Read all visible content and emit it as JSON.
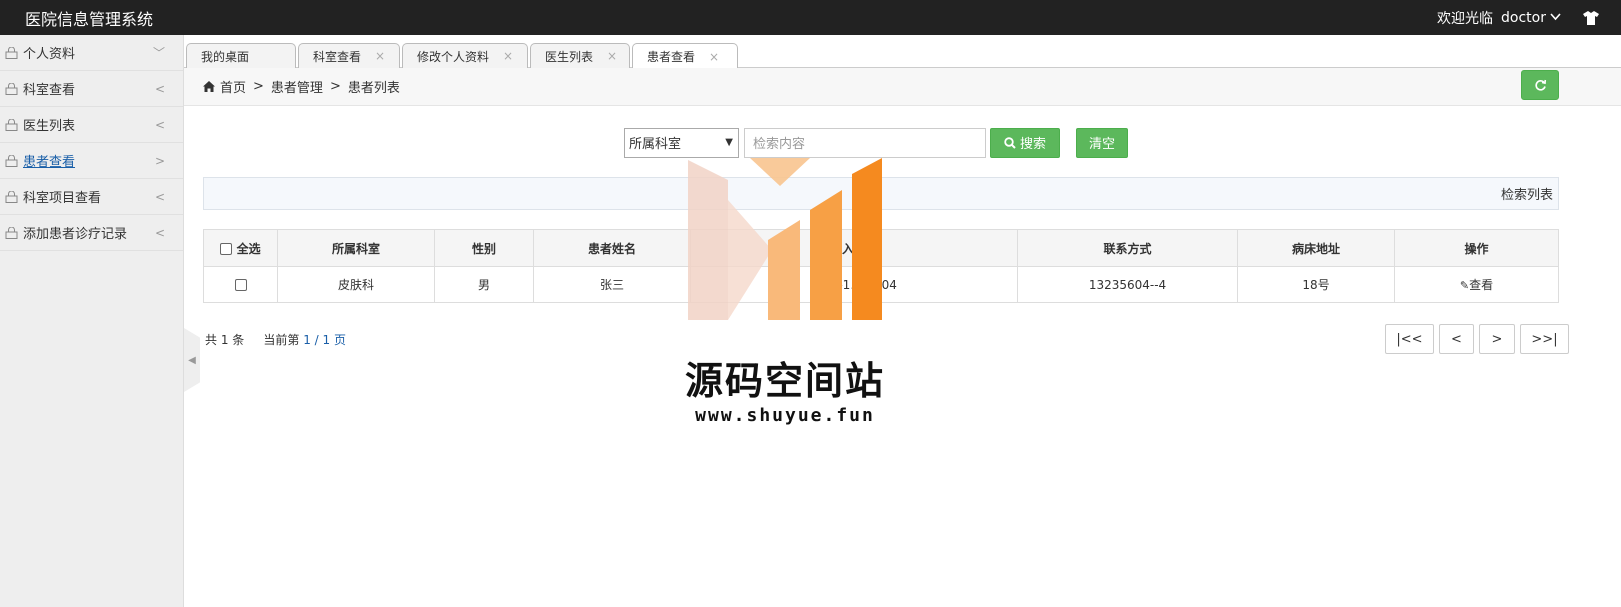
{
  "app": {
    "title": "医院信息管理系统",
    "welcome": "欢迎光临",
    "username": "doctor",
    "user_menu_icon": "chevron-down-icon",
    "theme_icon": "shirt-icon"
  },
  "sidebar": {
    "items": [
      {
        "label": "个人资料",
        "arrow": "﹀"
      },
      {
        "label": "科室查看",
        "arrow": "<"
      },
      {
        "label": "医生列表",
        "arrow": "<"
      },
      {
        "label": "患者查看",
        "arrow": ">"
      },
      {
        "label": "科室项目查看",
        "arrow": "<"
      },
      {
        "label": "添加患者诊疗记录",
        "arrow": "<"
      }
    ]
  },
  "tabs": [
    {
      "label": "我的桌面"
    },
    {
      "label": "科室查看"
    },
    {
      "label": "修改个人资料"
    },
    {
      "label": "医生列表"
    },
    {
      "label": "患者查看"
    }
  ],
  "breadcrumb": {
    "home": "首页",
    "sep": ">",
    "level1": "患者管理",
    "level2": "患者列表"
  },
  "search": {
    "dept_selected": "所属科室",
    "placeholder": "检索内容",
    "search_label": "搜索",
    "clear_label": "清空"
  },
  "list_title": "检索列表",
  "table": {
    "select_all": "全选",
    "headers": [
      "所属科室",
      "性别",
      "患者姓名",
      "入院",
      "联系方式",
      "病床地址",
      "操作"
    ],
    "rows": [
      {
        "dept": "皮肤科",
        "gender": "男",
        "name": "张三",
        "admit": "20…-1…47:04",
        "phone": "13235604--4",
        "bed": "18号",
        "action": "查看"
      }
    ]
  },
  "pager": {
    "total": "共 1 条",
    "current_label": "当前第",
    "current": "1 / 1 页",
    "first": "|<<",
    "prev": "<",
    "next": ">",
    "last": ">>|"
  },
  "watermark": {
    "text": "源码空间站",
    "url": "www.shuyue.fun"
  },
  "colors": {
    "topbar": "#222222",
    "green": "#5cb85c",
    "sidebar_bg": "#eeeeee",
    "link": "#1a5fa8"
  }
}
